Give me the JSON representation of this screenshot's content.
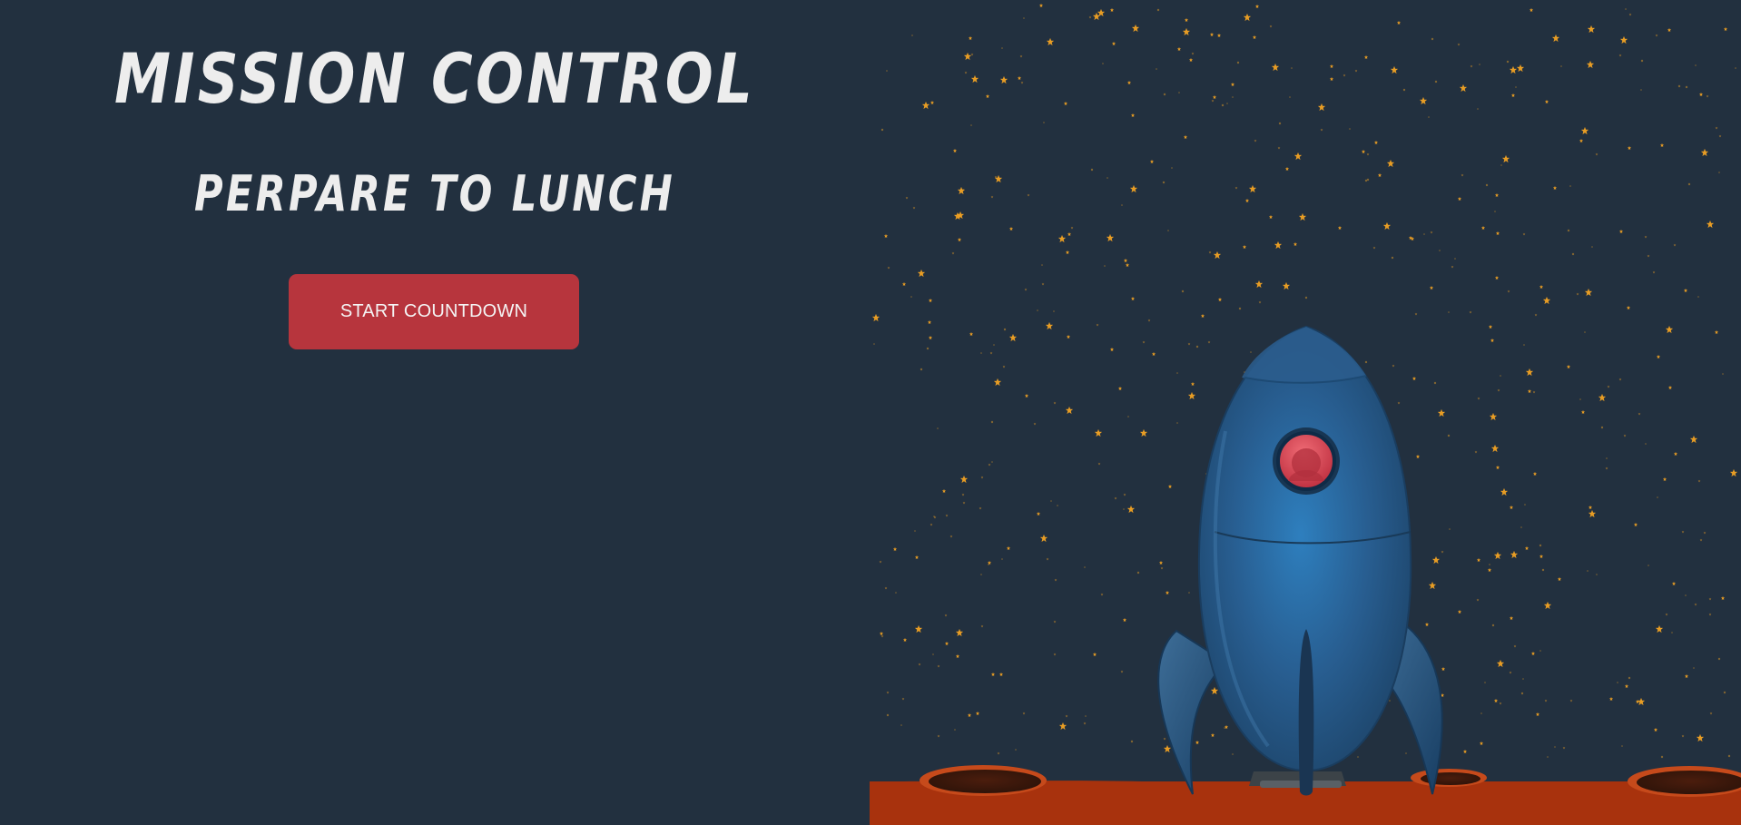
{
  "mission_title": "MISSION CONTROL",
  "mission_subtitle": "PERPARE TO LUNCH",
  "start_button_label": "START COUNTDOWN",
  "colors": {
    "background": "#22303f",
    "button": "#b7353d",
    "star": "#f3a323",
    "ground": "#a7310d",
    "rocket_body": "#2f6fa5",
    "porthole": "#d94a58"
  },
  "icons": {
    "rocket": "rocket-icon",
    "stars": "star-field",
    "ground": "planet-surface"
  }
}
